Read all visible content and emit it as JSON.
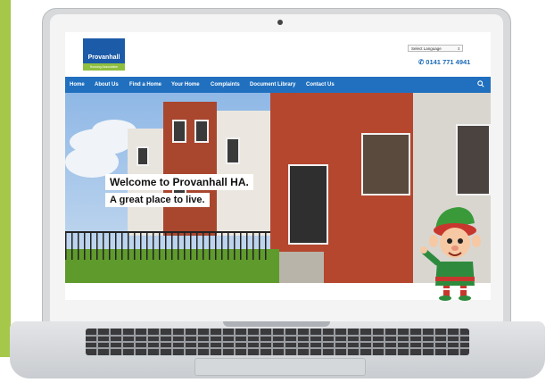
{
  "site": {
    "logo": {
      "name": "Provanhall",
      "tagline": "Housing Association"
    },
    "language_select": "Select Language",
    "phone": "0141 771 4941",
    "nav": [
      "Home",
      "About Us",
      "Find a Home",
      "Your Home",
      "Complaints",
      "Document Library",
      "Contact Us"
    ],
    "hero": {
      "headline": "Welcome to Provanhall HA.",
      "subheadline": "A great place to live."
    }
  },
  "colors": {
    "nav": "#2070bf",
    "logo_blue": "#1c5ba8",
    "logo_green": "#8fbf3f",
    "brand_strip": "#a6c84a"
  },
  "icons": [
    "phone-icon",
    "search-icon",
    "select-arrow-icon",
    "camera-icon"
  ]
}
